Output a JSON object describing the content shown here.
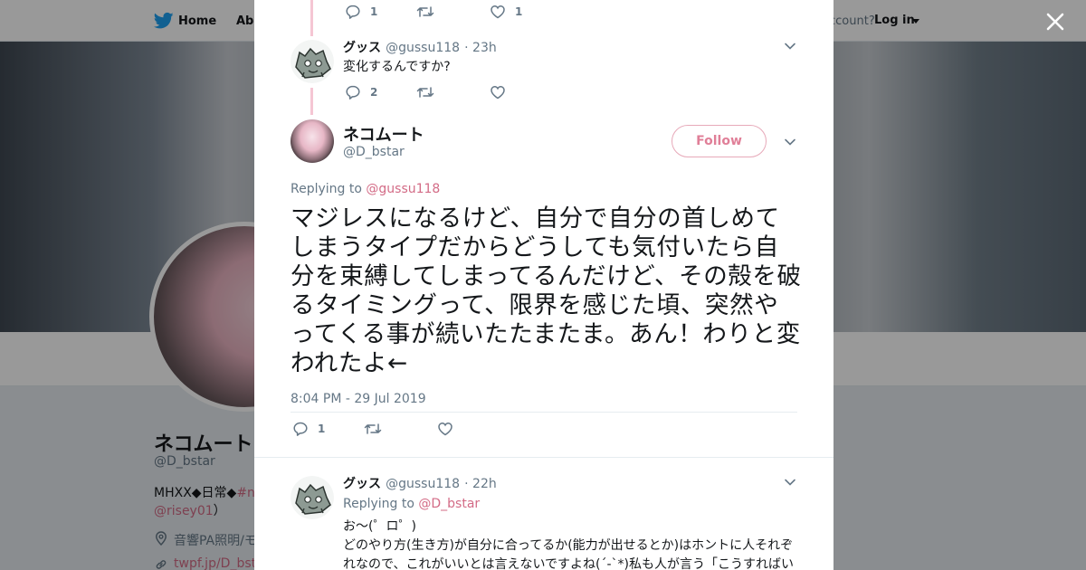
{
  "nav": {
    "home": "Home",
    "about": "Abo",
    "account_text": "ccount?",
    "login": "Log in"
  },
  "profile": {
    "name": "ネコムート",
    "handle": "@D_bstar",
    "bio_prefix": "MHXX◆日常◆",
    "bio_hashtag": "#n",
    "bio_mention": "@risey01",
    "bio_close": "）",
    "location": "音響PA照明/モ",
    "link": "twpf.jp/D_bsta"
  },
  "tweets": {
    "t1": {
      "replies": "1",
      "likes": "1"
    },
    "t2": {
      "name": "グッス",
      "handle": "@gussu118",
      "time": "· 23h",
      "text": "変化するんですか?",
      "replies": "2"
    },
    "main": {
      "name": "ネコムート",
      "handle": "@D_bstar",
      "follow": "Follow",
      "replying_label": "Replying to",
      "replying_to": "@gussu118",
      "text": "マジレスになるけど、自分で自分の首しめてしまうタイプだからどうしても気付いたら自分を束縛してしまってるんだけど、その殻を破るタイミングって、限界を感じた頃、突然やってくる事が続いたたまたま。あん！わりと変われたよ←",
      "timestamp": "8:04 PM - 29 Jul 2019",
      "replies": "1"
    },
    "t4": {
      "name": "グッス",
      "handle": "@gussu118",
      "time": "· 22h",
      "replying_label": "Replying to",
      "replying_to": "@D_bstar",
      "text_line1": "お～(゜ロ゜)",
      "text_rest": "どのやり方(生き方)が自分に合ってるか(能力が出せるとか)はホントに人それぞれなので、これがいいとは言えないですよね(´-`*)私も人が言う「こうすればい"
    }
  },
  "icons": {
    "twitter_bird": "twitter-bird-icon",
    "reply": "reply-icon",
    "retweet": "retweet-icon",
    "like": "heart-icon",
    "caret": "chevron-down-icon",
    "close": "close-icon",
    "location": "location-pin-icon",
    "link": "link-icon"
  },
  "colors": {
    "accent": "#d36b86",
    "follow_border": "#e7a9b9",
    "thread_line": "#f5c6d3",
    "secondary_text": "#657786"
  }
}
